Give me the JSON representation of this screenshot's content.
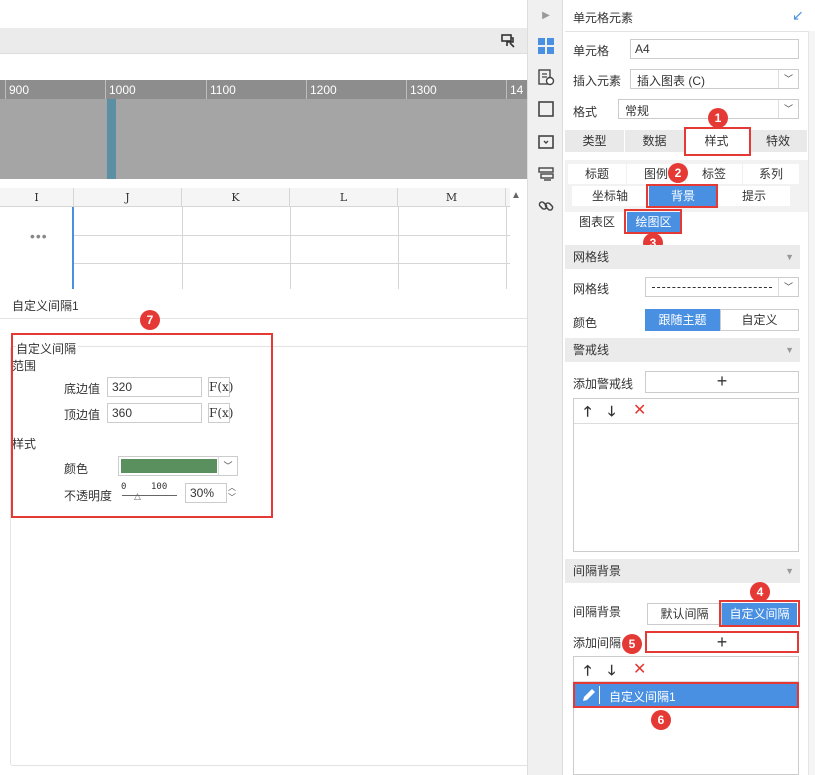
{
  "ruler": {
    "labels": [
      "900",
      "1000",
      "1100",
      "1200",
      "1300",
      "14"
    ]
  },
  "sheet": {
    "columns": [
      "I",
      "J",
      "K",
      "L",
      "M"
    ],
    "ellipsis": "•••"
  },
  "panel": {
    "title": "自定义间隔1",
    "group_title": "自定义间隔",
    "range_label": "范围",
    "bottom_label": "底边值",
    "bottom_value": "320",
    "top_label": "顶边值",
    "top_value": "360",
    "fx_label": "F(x)",
    "style_label": "样式",
    "color_label": "颜色",
    "color_value": "#5a8f5e",
    "opacity_label": "不透明度",
    "slider_min": "0",
    "slider_max": "100",
    "opacity_value": "30%"
  },
  "right": {
    "header": "单元格元素",
    "cell_label": "单元格",
    "cell_value": "A4",
    "insert_label": "插入元素",
    "insert_value": "插入图表 (C)",
    "format_label": "格式",
    "format_value": "常规",
    "tabs": [
      "类型",
      "数据",
      "样式",
      "特效"
    ],
    "subtabs1": [
      "标题",
      "图例",
      "标签",
      "系列"
    ],
    "subtabs2": [
      "坐标轴",
      "背景",
      "提示"
    ],
    "subtabs3": [
      "图表区",
      "绘图区"
    ],
    "grid_section": "网格线",
    "grid_label": "网格线",
    "color_label": "颜色",
    "color_opt1": "跟随主题",
    "color_opt2": "自定义",
    "alert_section": "警戒线",
    "add_alert_label": "添加警戒线",
    "plus": "+",
    "interval_section": "间隔背景",
    "interval_label": "间隔背景",
    "interval_opt1": "默认间隔",
    "interval_opt2": "自定义间隔",
    "add_interval_label": "添加间隔",
    "list_item": "自定义间隔1"
  },
  "badges": [
    "1",
    "2",
    "3",
    "4",
    "5",
    "6",
    "7"
  ],
  "colors": {
    "accent": "#4a90e2",
    "highlight": "#e53935"
  }
}
